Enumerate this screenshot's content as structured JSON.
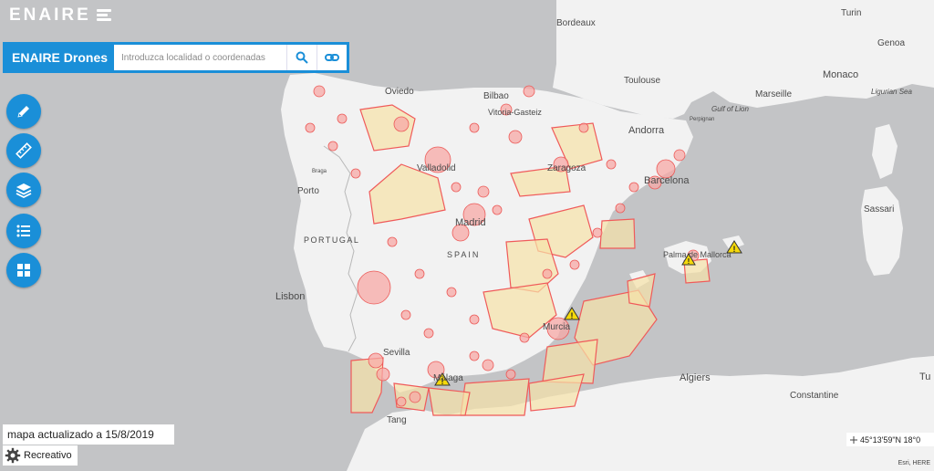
{
  "header": {
    "logo_text": "ENAIRE"
  },
  "search": {
    "brand": "ENAIRE Drones",
    "placeholder": "Introduzca localidad o coordenadas"
  },
  "tools": [
    {
      "icon": "pencil-icon"
    },
    {
      "icon": "ruler-icon"
    },
    {
      "icon": "layers-icon"
    },
    {
      "icon": "list-icon"
    },
    {
      "icon": "grid-icon"
    }
  ],
  "update": {
    "text": "mapa actualizado a  15/8/2019"
  },
  "mode": {
    "label": "Recreativo",
    "icon": "gear-icon"
  },
  "coords": {
    "text": "45°13'59\"N 18°0"
  },
  "attribution": "Esri, HERE",
  "map": {
    "labels": {
      "bordeaux": "Bordeaux",
      "turin": "Turin",
      "genoa": "Genoa",
      "toulouse": "Toulouse",
      "monaco": "Monaco",
      "marseille": "Marseille",
      "ligurian_sea": "Ligurian Sea",
      "gulf_of_lion": "Gulf of Lion",
      "oviedo": "Oviedo",
      "bilbao": "Bilbao",
      "vitoria": "Vitoria-Gasteiz",
      "andorra": "Andorra",
      "valladolid": "Valladolid",
      "zaragoza": "Zaragoza",
      "barcelona": "Barcelona",
      "porto": "Porto",
      "madrid": "Madrid",
      "portugal": "PORTUGAL",
      "spain": "SPAIN",
      "sassari": "Sassari",
      "palma": "Palma de Mallorca",
      "lisbon": "Lisbon",
      "murcia": "Murcia",
      "sevilla": "Sevilla",
      "malaga": "Málaga",
      "algiers": "Algiers",
      "constantine": "Constantine",
      "tang": "Tang",
      "perpignan": "Perpignan",
      "braga": "Braga",
      "tunis": "Tu"
    },
    "colors": {
      "water": "#c3c4c6",
      "land": "#f2f2f2",
      "zone_fill": "#f7d9a8",
      "zone_red": "#f05a5a",
      "zone_pink": "#f8b2b0",
      "warning": "#f5d90a"
    }
  }
}
